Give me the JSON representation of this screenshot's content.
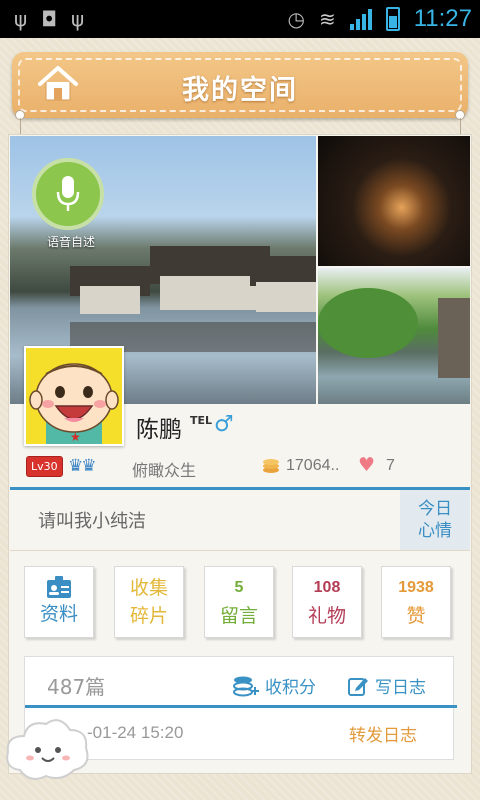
{
  "status_bar": {
    "time": "11:27",
    "icons_left": [
      "usb-icon",
      "android-icon",
      "usb-icon"
    ],
    "icons_right": [
      "alarm-icon",
      "wifi-icon",
      "signal-icon",
      "battery-icon"
    ]
  },
  "header": {
    "title": "我的空间",
    "home_icon": "home-icon"
  },
  "profile": {
    "voice_label": "语音自述",
    "name": "陈鹏",
    "tel_badge": "TEL",
    "gender_symbol": "♂",
    "level": "Lv30",
    "title": "俯瞰众生",
    "coins": "17064..",
    "likes": "7"
  },
  "mood": {
    "text": "请叫我小纯洁",
    "button_line1": "今日",
    "button_line2": "心情"
  },
  "tiles": [
    {
      "line1": "",
      "line2": "资料",
      "color": "#3a8ec3"
    },
    {
      "line1": "收集",
      "line2": "碎片",
      "color": "#e3b83a"
    },
    {
      "line1": "5",
      "line2": "留言",
      "color": "#74ae3a"
    },
    {
      "line1": "108",
      "line2": "礼物",
      "color": "#b43c54"
    },
    {
      "line1": "1938",
      "line2": "赞",
      "color": "#e59a3a"
    }
  ],
  "journal": {
    "count": "487篇",
    "collect_label": "收积分",
    "write_label": "写日志",
    "date": "-01-24 15:20",
    "forward_label": "转发日志"
  },
  "colors": {
    "accent_blue": "#3a92c4",
    "header_orange": "#eeb974"
  }
}
